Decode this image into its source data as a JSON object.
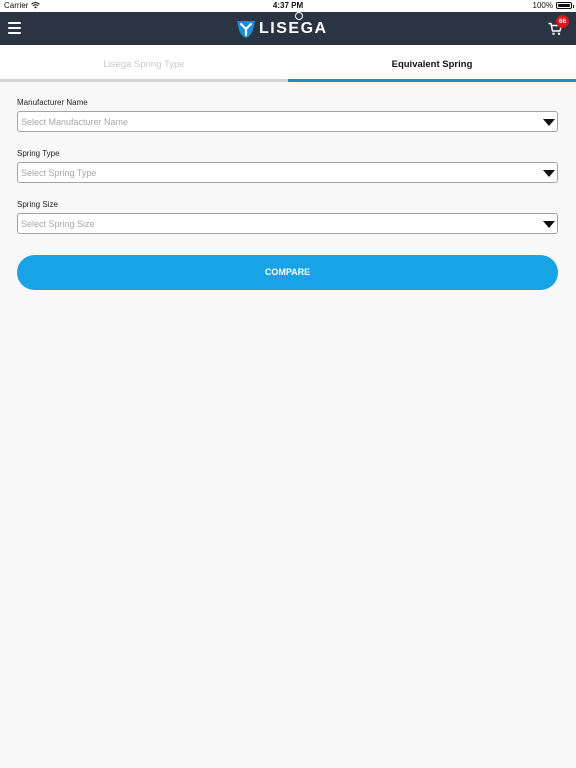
{
  "status_bar": {
    "carrier": "Carrier",
    "time": "4:37 PM",
    "battery": "100%",
    "battery_level": 1.0
  },
  "navbar": {
    "logo_text": "LISEGA",
    "cart_count": "66"
  },
  "tabs": [
    {
      "label": "Lisega Spring Type",
      "active": false
    },
    {
      "label": "Equivalent Spring",
      "active": true
    }
  ],
  "form": {
    "manufacturer": {
      "label": "Manufacturer Name",
      "placeholder": "Select Manufacturer Name"
    },
    "spring_type": {
      "label": "Spring Type",
      "placeholder": "Select Spring Type"
    },
    "spring_size": {
      "label": "Spring Size",
      "placeholder": "Select Spring Size"
    },
    "compare_label": "COMPARE"
  },
  "colors": {
    "navbar": "#2a3442",
    "accent": "#18a3e6",
    "tab_active_line": "#1a8fd6",
    "badge": "#e0141e",
    "background": "#f9f8f9"
  }
}
